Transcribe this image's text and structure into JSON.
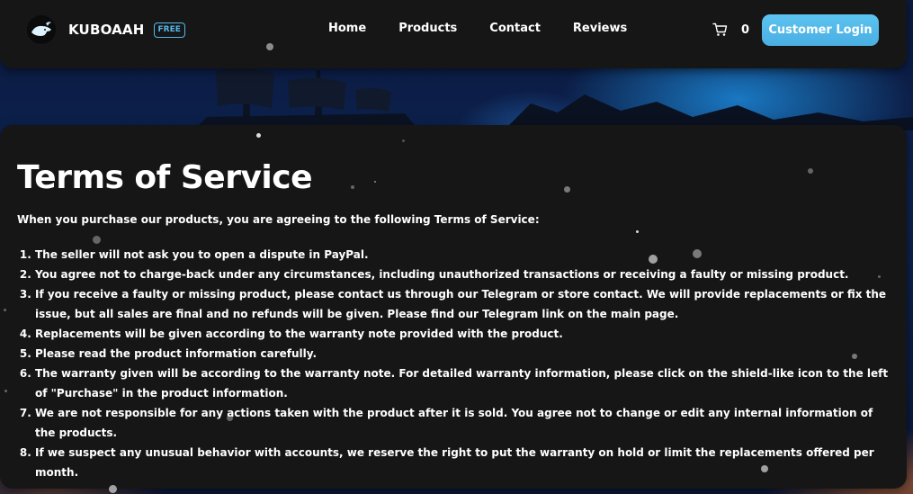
{
  "brand": {
    "name": "KUBOAAH",
    "badge": "FREE"
  },
  "nav": {
    "items": [
      {
        "label": "Home"
      },
      {
        "label": "Products"
      },
      {
        "label": "Contact"
      },
      {
        "label": "Reviews"
      }
    ]
  },
  "cart": {
    "count": "0",
    "icon": "cart-icon"
  },
  "login": {
    "label": "Customer Login"
  },
  "content": {
    "title": "Terms of Service",
    "intro": "When you purchase our products, you are agreeing to the following Terms of Service:",
    "terms": [
      "The seller will not ask you to open a dispute in PayPal.",
      "You agree not to charge-back under any circumstances, including unauthorized transactions or receiving a faulty or missing product.",
      "If you receive a faulty or missing product, please contact us through our Telegram or store contact. We will provide replacements or fix the issue, but all sales are final and no refunds will be given. Please find our Telegram link on the main page.",
      "Replacements will be given according to the warranty note provided with the product.",
      "Please read the product information carefully.",
      "The warranty given will be according to the warranty note. For detailed warranty information, please click on the shield-like icon to the left of \"Purchase\" in the product information.",
      "We are not responsible for any actions taken with the product after it is sold. You agree not to change or edit any internal information of the products.",
      "If we suspect any unusual behavior with accounts, we reserve the right to put the warranty on hold or limit the replacements offered per month."
    ]
  },
  "colors": {
    "panel": "#161616",
    "accent": "#55b8ea",
    "button": "#4aaee2",
    "text": "#ffffff"
  }
}
